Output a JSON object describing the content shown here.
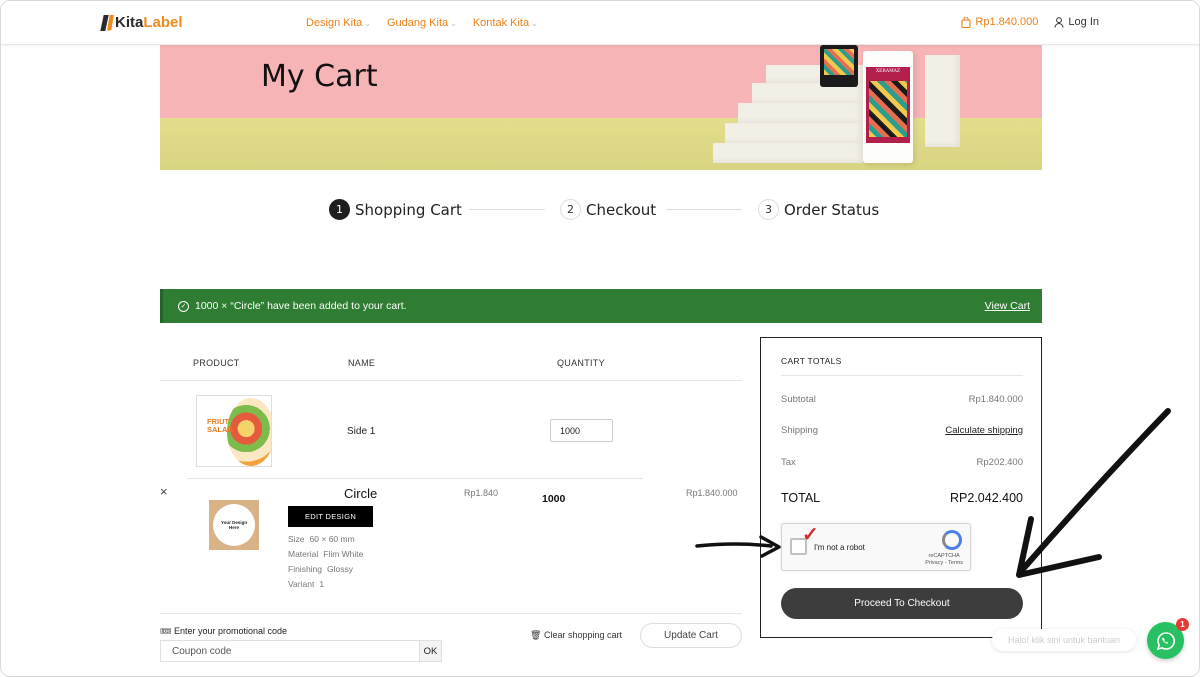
{
  "header": {
    "logo_prefix": "Kita",
    "logo_suffix": "Label",
    "nav": [
      {
        "label": "Design Kita"
      },
      {
        "label": "Gudang Kita"
      },
      {
        "label": "Kontak Kita"
      }
    ],
    "cart_amount": "Rp1.840.000",
    "login_label": "Log In"
  },
  "banner": {
    "title": "My Cart",
    "pack_text_1": "XERAMAZ"
  },
  "stepper": [
    {
      "num": "1",
      "label": "Shopping Cart",
      "active": true
    },
    {
      "num": "2",
      "label": "Checkout",
      "active": false
    },
    {
      "num": "3",
      "label": "Order Status",
      "active": false
    }
  ],
  "notice": {
    "message": "1000 × “Circle” have been added to your cart.",
    "link": "View Cart"
  },
  "table": {
    "headers": [
      "PRODUCT",
      "NAME",
      "QUANTITY"
    ],
    "side_row": {
      "name": "Side 1",
      "quantity": "1000"
    },
    "item": {
      "remove": "×",
      "name": "Circle",
      "edit_label": "EDIT DESIGN",
      "thumb_text": "Your Design Here",
      "thumb1_lines": [
        "FRIUT",
        "SALAD"
      ],
      "meta": [
        {
          "key": "Size",
          "value": "60 × 60 mm"
        },
        {
          "key": "Material",
          "value": "Flim White"
        },
        {
          "key": "Finishing",
          "value": "Glossy"
        },
        {
          "key": "Variant",
          "value": "1"
        }
      ],
      "unit_price": "Rp1.840",
      "quantity": "1000",
      "total": "Rp1.840.000"
    }
  },
  "promo": {
    "label": "Enter your promotional code",
    "placeholder": "Coupon code",
    "ok": "OK"
  },
  "actions": {
    "clear": "Clear shopping cart",
    "update": "Update Cart"
  },
  "totals": {
    "title": "CART TOTALS",
    "rows": [
      {
        "label": "Subtotal",
        "value": "Rp1.840.000"
      },
      {
        "label": "Shipping",
        "value": "Calculate shipping"
      },
      {
        "label": "Tax",
        "value": "Rp202.400"
      }
    ],
    "total_label": "TOTAL",
    "total_value": "RP2.042.400",
    "captcha_label": "I'm not a robot",
    "captcha_brand": "reCAPTCHA",
    "captcha_links": "Privacy - Terms",
    "checkout": "Proceed To Checkout"
  },
  "chat": {
    "tooltip": "Halo! klik sini untuk bantuan",
    "badge": "1"
  },
  "colors": {
    "accent": "#ee7f18",
    "notice_green": "#2f7d32",
    "banner_pink": "#f6b4b6",
    "whatsapp": "#27c163"
  }
}
